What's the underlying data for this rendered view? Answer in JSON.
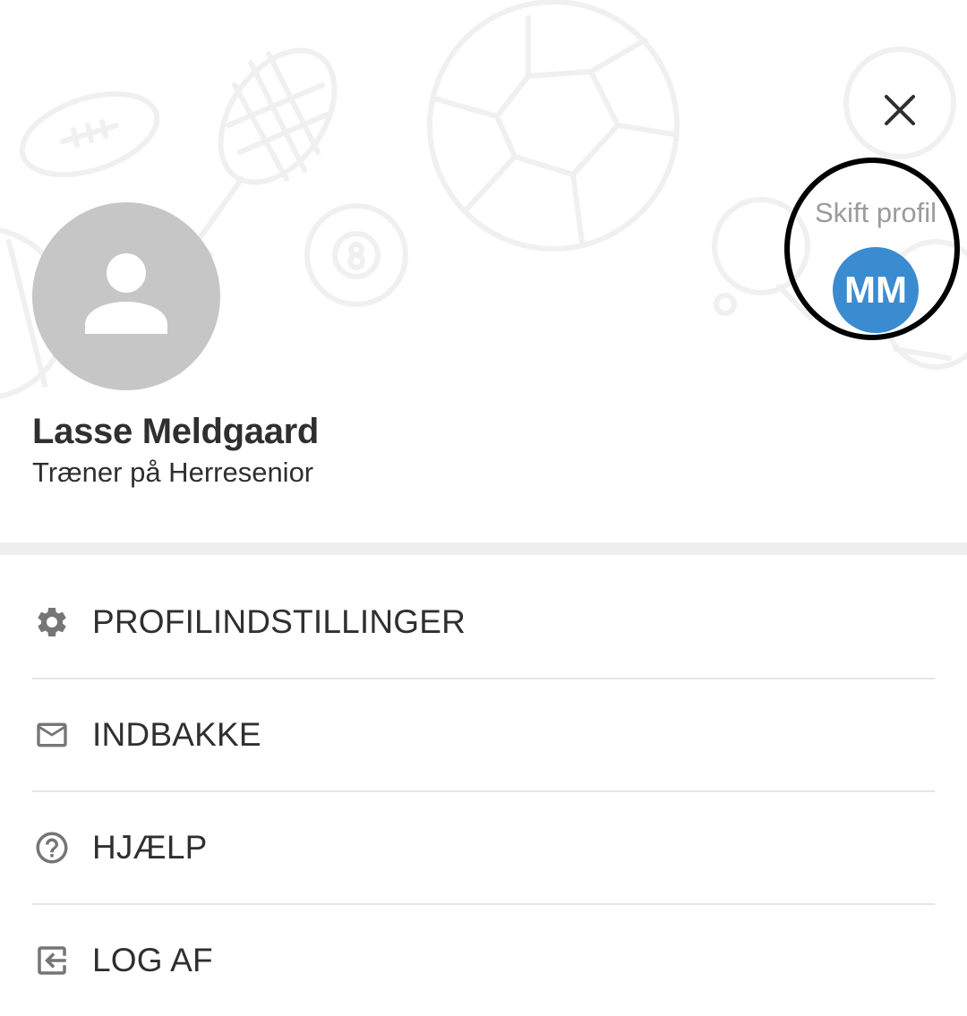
{
  "profile": {
    "name": "Lasse Meldgaard",
    "role": "Træner på Herresenior"
  },
  "switch_profile": {
    "label": "Skift profil",
    "initials": "MM",
    "avatar_color": "#3b8bd0"
  },
  "close": {
    "icon": "close-icon"
  },
  "menu": {
    "items": [
      {
        "label": "PROFILINDSTILLINGER",
        "icon": "gear-icon"
      },
      {
        "label": "INDBAKKE",
        "icon": "mail-icon"
      },
      {
        "label": "HJÆLP",
        "icon": "help-icon"
      },
      {
        "label": "LOG AF",
        "icon": "logout-icon"
      }
    ]
  },
  "colors": {
    "text": "#2f2f2f",
    "muted": "#9b9b9b",
    "icon": "#757575",
    "avatar_placeholder": "#c6c6c6",
    "divider": "#eeeeee"
  }
}
